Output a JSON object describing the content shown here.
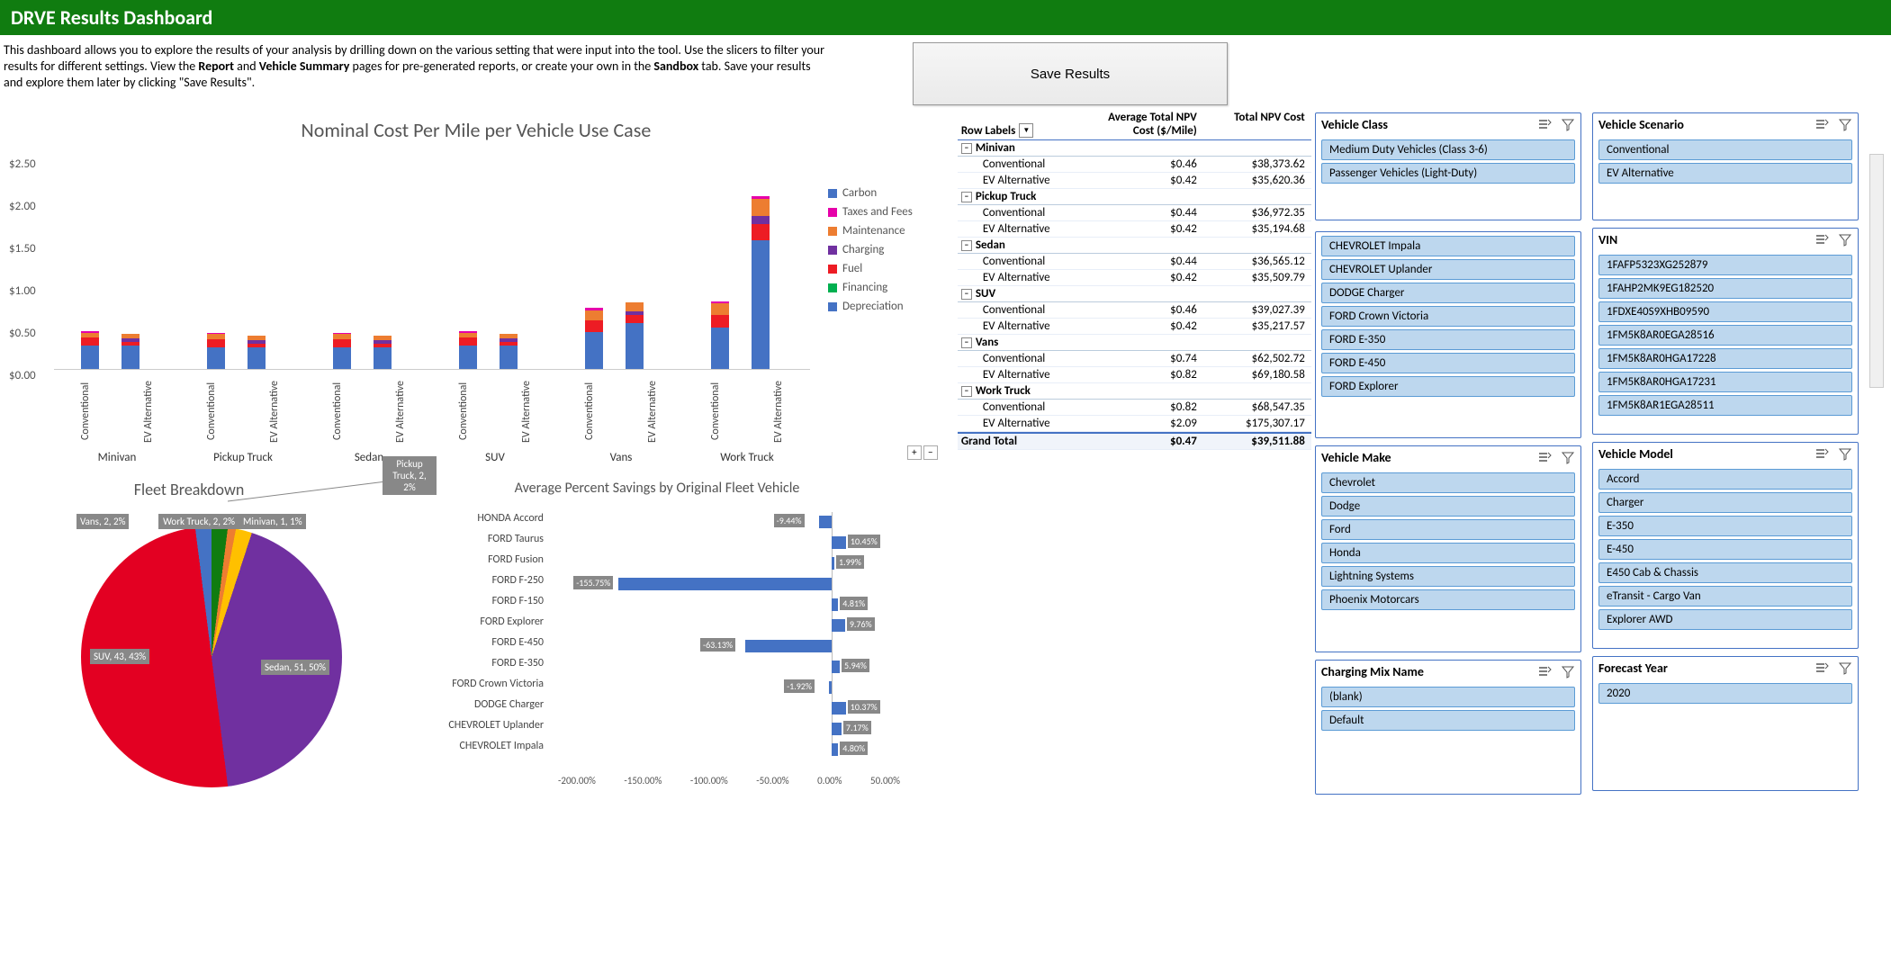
{
  "header": {
    "title": "DRVE Results Dashboard"
  },
  "intro": {
    "pre": "This dashboard allows you to explore the results of your analysis by drilling down on the various setting that were input into the tool. Use the slicers to filter your results for different settings. View the ",
    "b1": "Report",
    "mid1": " and ",
    "b2": "Vehicle Summary",
    "mid2": " pages for pre-generated reports, or create your own in the ",
    "b3": "Sandbox",
    "post": " tab. Save your results and explore them later by clicking \"Save Results\"."
  },
  "save_label": "Save Results",
  "chart_data": [
    {
      "type": "bar",
      "title": "Nominal Cost Per Mile per Vehicle Use Case",
      "ylim": [
        0,
        2.5
      ],
      "yticks": [
        "$2.50",
        "$2.00",
        "$1.50",
        "$1.00",
        "$0.50",
        "$0.00"
      ],
      "legend": [
        "Carbon",
        "Taxes and Fees",
        "Maintenance",
        "Charging",
        "Fuel",
        "Financing",
        "Depreciation"
      ],
      "categories": [
        "Minivan",
        "Pickup Truck",
        "Sedan",
        "SUV",
        "Vans",
        "Work Truck"
      ],
      "sub": [
        "Conventional",
        "EV Alternative"
      ],
      "stacks": {
        "Minivan": {
          "Conventional": {
            "dep": 0.28,
            "fuel": 0.1,
            "maint": 0.06,
            "tax": 0.02
          },
          "EV Alternative": {
            "dep": 0.28,
            "chg": 0.04,
            "fuel": 0.05,
            "maint": 0.05
          }
        },
        "Pickup Truck": {
          "Conventional": {
            "dep": 0.26,
            "fuel": 0.1,
            "maint": 0.06,
            "tax": 0.02
          },
          "EV Alternative": {
            "dep": 0.26,
            "chg": 0.04,
            "fuel": 0.05,
            "maint": 0.05
          }
        },
        "Sedan": {
          "Conventional": {
            "dep": 0.26,
            "fuel": 0.1,
            "maint": 0.06,
            "tax": 0.02
          },
          "EV Alternative": {
            "dep": 0.26,
            "chg": 0.04,
            "fuel": 0.05,
            "maint": 0.05
          }
        },
        "SUV": {
          "Conventional": {
            "dep": 0.28,
            "fuel": 0.1,
            "maint": 0.06,
            "tax": 0.02
          },
          "EV Alternative": {
            "dep": 0.28,
            "chg": 0.04,
            "fuel": 0.05,
            "maint": 0.05
          }
        },
        "Vans": {
          "Conventional": {
            "dep": 0.45,
            "fuel": 0.14,
            "maint": 0.12,
            "tax": 0.03
          },
          "EV Alternative": {
            "dep": 0.55,
            "chg": 0.05,
            "fuel": 0.1,
            "maint": 0.1
          }
        },
        "Work Truck": {
          "Conventional": {
            "dep": 0.5,
            "fuel": 0.15,
            "maint": 0.14,
            "tax": 0.03
          },
          "EV Alternative": {
            "dep": 1.55,
            "chg": 0.1,
            "fuel": 0.2,
            "maint": 0.2,
            "tax": 0.04
          }
        }
      }
    },
    {
      "type": "pie",
      "title": "Fleet Breakdown",
      "slices": [
        {
          "label": "Sedan, 51, 50%",
          "value": 50,
          "color": "#E30022"
        },
        {
          "label": "SUV, 43, 43%",
          "value": 43,
          "color": "#7030A0"
        },
        {
          "label": "Vans, 2, 2%",
          "value": 2,
          "color": "#FFC000"
        },
        {
          "label": "Work Truck, 2, 2%",
          "value": 2,
          "color": "#4472C4"
        },
        {
          "label": "Pickup Truck, 2, 2%",
          "value": 2,
          "color": "#107C10"
        },
        {
          "label": "Minivan, 1, 1%",
          "value": 1,
          "color": "#ED7D31"
        }
      ]
    },
    {
      "type": "bar",
      "title": "Average Percent Savings by Original Fleet Vehicle",
      "orientation": "horizontal",
      "xlim": [
        -200,
        50
      ],
      "xticks": [
        "-200.00%",
        "-150.00%",
        "-100.00%",
        "-50.00%",
        "0.00%",
        "50.00%"
      ],
      "categories": [
        "HONDA Accord",
        "FORD Taurus",
        "FORD Fusion",
        "FORD F-250",
        "FORD F-150",
        "FORD Explorer",
        "FORD E-450",
        "FORD E-350",
        "FORD Crown Victoria",
        "DODGE Charger",
        "CHEVROLET Uplander",
        "CHEVROLET Impala"
      ],
      "values": [
        -9.44,
        10.45,
        1.99,
        -155.75,
        4.81,
        9.76,
        -63.13,
        5.94,
        -1.92,
        10.37,
        7.17,
        4.8
      ],
      "value_labels": [
        "-9.44%",
        "10.45%",
        "1.99%",
        "-155.75%",
        "4.81%",
        "9.76%",
        "-63.13%",
        "5.94%",
        "-1.92%",
        "10.37%",
        "7.17%",
        "4.80%"
      ]
    }
  ],
  "pivot": {
    "hdr": {
      "c1": "Row Labels",
      "c2": "Average Total NPV Cost ($/Mile)",
      "c3": "Total NPV Cost"
    },
    "groups": [
      {
        "name": "Minivan",
        "rows": [
          {
            "l": "Conventional",
            "a": "$0.46",
            "b": "$38,373.62"
          },
          {
            "l": "EV Alternative",
            "a": "$0.42",
            "b": "$35,620.36"
          }
        ]
      },
      {
        "name": "Pickup Truck",
        "rows": [
          {
            "l": "Conventional",
            "a": "$0.44",
            "b": "$36,972.35"
          },
          {
            "l": "EV Alternative",
            "a": "$0.42",
            "b": "$35,194.68"
          }
        ]
      },
      {
        "name": "Sedan",
        "rows": [
          {
            "l": "Conventional",
            "a": "$0.44",
            "b": "$36,565.12"
          },
          {
            "l": "EV Alternative",
            "a": "$0.42",
            "b": "$35,509.79"
          }
        ]
      },
      {
        "name": "SUV",
        "rows": [
          {
            "l": "Conventional",
            "a": "$0.46",
            "b": "$39,027.39"
          },
          {
            "l": "EV Alternative",
            "a": "$0.42",
            "b": "$35,217.57"
          }
        ]
      },
      {
        "name": "Vans",
        "rows": [
          {
            "l": "Conventional",
            "a": "$0.74",
            "b": "$62,502.72"
          },
          {
            "l": "EV Alternative",
            "a": "$0.82",
            "b": "$69,180.58"
          }
        ]
      },
      {
        "name": "Work Truck",
        "rows": [
          {
            "l": "Conventional",
            "a": "$0.82",
            "b": "$68,547.35"
          },
          {
            "l": "EV Alternative",
            "a": "$2.09",
            "b": "$175,307.17"
          }
        ]
      }
    ],
    "total": {
      "l": "Grand Total",
      "a": "$0.47",
      "b": "$39,511.88"
    }
  },
  "slicers": {
    "vehicle_class": {
      "title": "Vehicle Class",
      "items": [
        "Medium Duty Vehicles (Class 3-6)",
        "Passenger Vehicles (Light-Duty)"
      ]
    },
    "vehicle_scenario": {
      "title": "Vehicle Scenario",
      "items": [
        "Conventional",
        "EV Alternative"
      ]
    },
    "name_col_title": "",
    "name_col": {
      "items": [
        "CHEVROLET Impala",
        "CHEVROLET Uplander",
        "DODGE Charger",
        "FORD Crown Victoria",
        "FORD E-350",
        "FORD E-450",
        "FORD Explorer"
      ]
    },
    "vin": {
      "title": "VIN",
      "items": [
        "1FAFP5323XG252879",
        "1FAHP2MK9EG182520",
        "1FDXE40S9XHB09590",
        "1FM5K8AR0EGA28516",
        "1FM5K8AR0HGA17228",
        "1FM5K8AR0HGA17231",
        "1FM5K8AR1EGA28511"
      ]
    },
    "vehicle_make": {
      "title": "Vehicle Make",
      "items": [
        "Chevrolet",
        "Dodge",
        "Ford",
        "Honda",
        "Lightning Systems",
        "Phoenix Motorcars"
      ]
    },
    "vehicle_model": {
      "title": "Vehicle Model",
      "items": [
        "Accord",
        "Charger",
        "E-350",
        "E-450",
        "E450 Cab & Chassis",
        "eTransit - Cargo Van",
        "Explorer AWD"
      ]
    },
    "charging_mix": {
      "title": "Charging Mix Name",
      "items": [
        "(blank)",
        "Default"
      ]
    },
    "forecast_year": {
      "title": "Forecast Year",
      "items": [
        "2020"
      ]
    }
  },
  "icons": {
    "multi": "≡",
    "clear": "⚲"
  }
}
